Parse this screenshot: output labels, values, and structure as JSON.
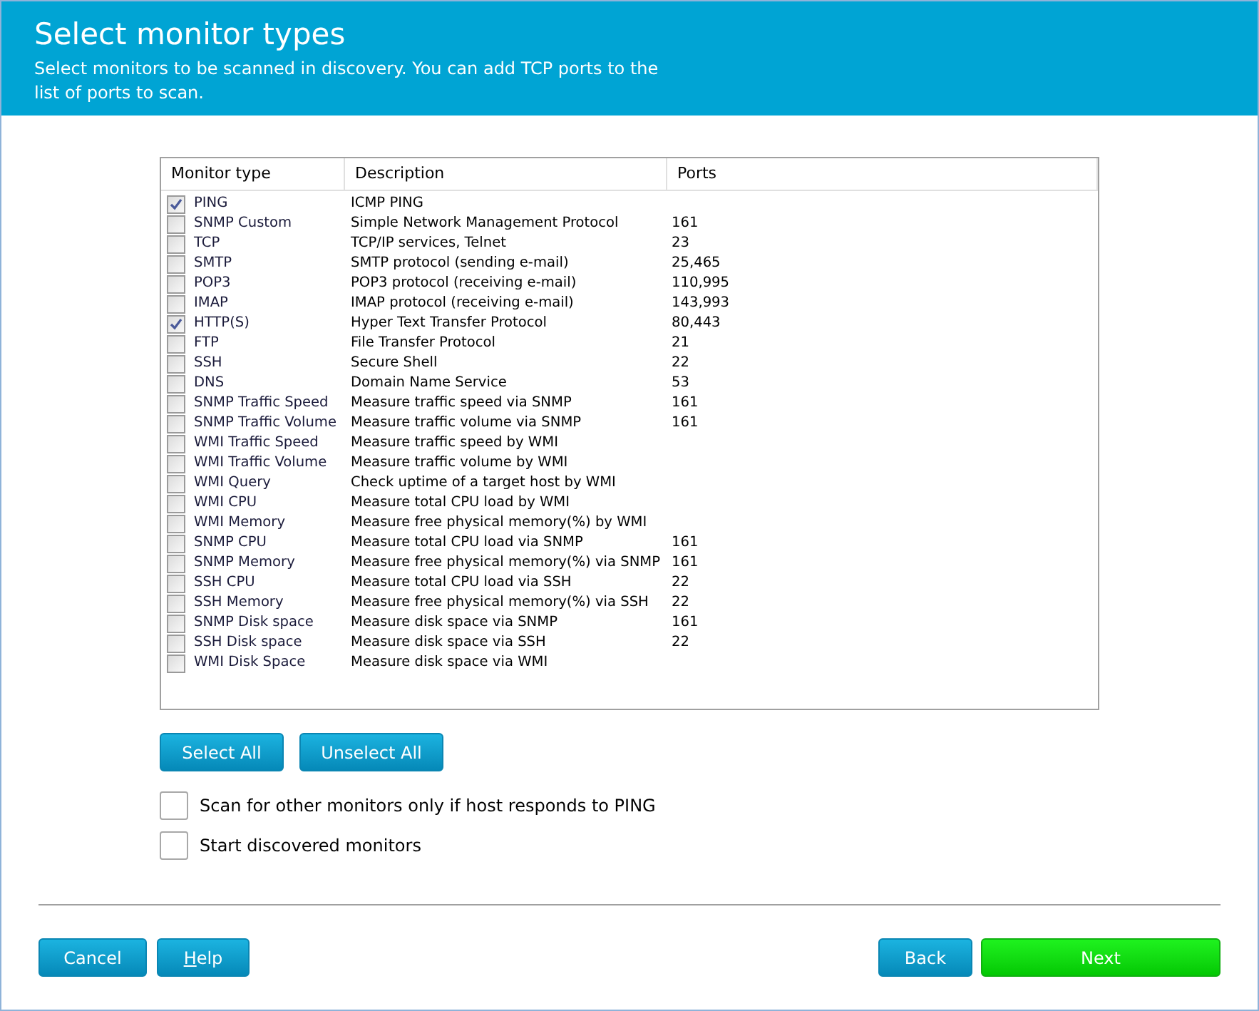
{
  "header": {
    "title": "Select monitor types",
    "subtitle": "Select monitors to be scanned in discovery. You can add TCP ports to the list of ports to scan."
  },
  "table": {
    "columns": [
      "Monitor type",
      "Description",
      "Ports"
    ],
    "rows": [
      {
        "checked": true,
        "type": "PING",
        "description": "ICMP PING",
        "ports": ""
      },
      {
        "checked": false,
        "type": "SNMP Custom",
        "description": "Simple Network Management Protocol",
        "ports": "161"
      },
      {
        "checked": false,
        "type": "TCP",
        "description": "TCP/IP services, Telnet",
        "ports": "23"
      },
      {
        "checked": false,
        "type": "SMTP",
        "description": "SMTP protocol (sending e-mail)",
        "ports": "25,465"
      },
      {
        "checked": false,
        "type": "POP3",
        "description": "POP3 protocol (receiving e-mail)",
        "ports": "110,995"
      },
      {
        "checked": false,
        "type": "IMAP",
        "description": "IMAP protocol (receiving e-mail)",
        "ports": "143,993"
      },
      {
        "checked": true,
        "type": "HTTP(S)",
        "description": "Hyper Text Transfer Protocol",
        "ports": "80,443"
      },
      {
        "checked": false,
        "type": "FTP",
        "description": "File Transfer Protocol",
        "ports": "21"
      },
      {
        "checked": false,
        "type": "SSH",
        "description": "Secure Shell",
        "ports": "22"
      },
      {
        "checked": false,
        "type": "DNS",
        "description": "Domain Name Service",
        "ports": "53"
      },
      {
        "checked": false,
        "type": "SNMP Traffic Speed",
        "description": "Measure traffic speed via SNMP",
        "ports": "161"
      },
      {
        "checked": false,
        "type": "SNMP Traffic Volume",
        "description": "Measure traffic volume via SNMP",
        "ports": "161"
      },
      {
        "checked": false,
        "type": "WMI Traffic Speed",
        "description": "Measure traffic speed by WMI",
        "ports": ""
      },
      {
        "checked": false,
        "type": "WMI Traffic Volume",
        "description": "Measure traffic volume by WMI",
        "ports": ""
      },
      {
        "checked": false,
        "type": "WMI Query",
        "description": "Check uptime of a target host by WMI",
        "ports": ""
      },
      {
        "checked": false,
        "type": "WMI CPU",
        "description": "Measure total CPU load by WMI",
        "ports": ""
      },
      {
        "checked": false,
        "type": "WMI Memory",
        "description": "Measure free physical memory(%) by WMI",
        "ports": ""
      },
      {
        "checked": false,
        "type": "SNMP CPU",
        "description": "Measure total CPU load via SNMP",
        "ports": "161"
      },
      {
        "checked": false,
        "type": "SNMP Memory",
        "description": "Measure free physical memory(%) via SNMP",
        "ports": "161"
      },
      {
        "checked": false,
        "type": "SSH CPU",
        "description": "Measure total CPU load via SSH",
        "ports": "22"
      },
      {
        "checked": false,
        "type": "SSH Memory",
        "description": "Measure free physical memory(%) via SSH",
        "ports": "22"
      },
      {
        "checked": false,
        "type": "SNMP Disk space",
        "description": "Measure disk space via SNMP",
        "ports": "161"
      },
      {
        "checked": false,
        "type": "SSH Disk space",
        "description": "Measure disk space via SSH",
        "ports": "22"
      },
      {
        "checked": false,
        "type": "WMI Disk Space",
        "description": "Measure disk space via WMI",
        "ports": ""
      }
    ]
  },
  "table_buttons": [
    "Select All",
    "Unselect All"
  ],
  "options": [
    {
      "label": "Scan for other monitors only if host responds to PING",
      "checked": false
    },
    {
      "label": "Start discovered monitors",
      "checked": false
    }
  ],
  "footer_left": [
    {
      "label": "Cancel",
      "first_letter_underlined": false
    },
    {
      "label": "Help",
      "first_letter_underlined": true
    }
  ],
  "footer_right": [
    {
      "label": "Back",
      "kind": "normal"
    },
    {
      "label": "Next",
      "kind": "primary"
    }
  ]
}
